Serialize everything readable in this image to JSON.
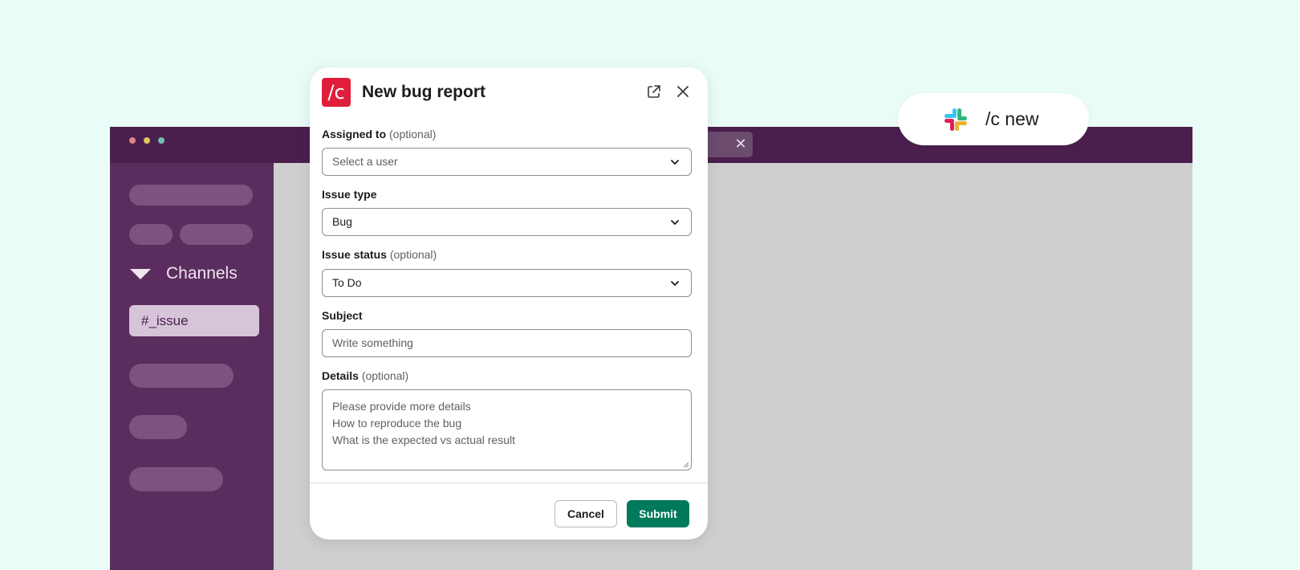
{
  "background": {
    "colors": {
      "page": "#eafcf8",
      "titlebar": "#4a1f4d",
      "sidebar": "#5b2d5e",
      "content": "#cfcfcf"
    }
  },
  "sidebar": {
    "channels_header": "Channels",
    "active_channel": "#_issue"
  },
  "command_pill": {
    "text": "/c new",
    "icon": "slack-logo-icon"
  },
  "modal": {
    "app_icon_text": "/c",
    "title": "New bug report",
    "fields": {
      "assigned_to": {
        "label": "Assigned to",
        "optional": "(optional)",
        "placeholder": "Select a user"
      },
      "issue_type": {
        "label": "Issue type",
        "value": "Bug"
      },
      "issue_status": {
        "label": "Issue status",
        "optional": "(optional)",
        "value": "To Do"
      },
      "subject": {
        "label": "Subject",
        "placeholder": "Write something"
      },
      "details": {
        "label": "Details",
        "optional": "(optional)",
        "placeholder_lines": [
          "Please provide more details",
          "How to reproduce the bug",
          "What is the expected vs actual result"
        ]
      }
    },
    "buttons": {
      "cancel": "Cancel",
      "submit": "Submit"
    },
    "colors": {
      "app_icon": "#e01e3c",
      "submit": "#007a5a"
    }
  }
}
